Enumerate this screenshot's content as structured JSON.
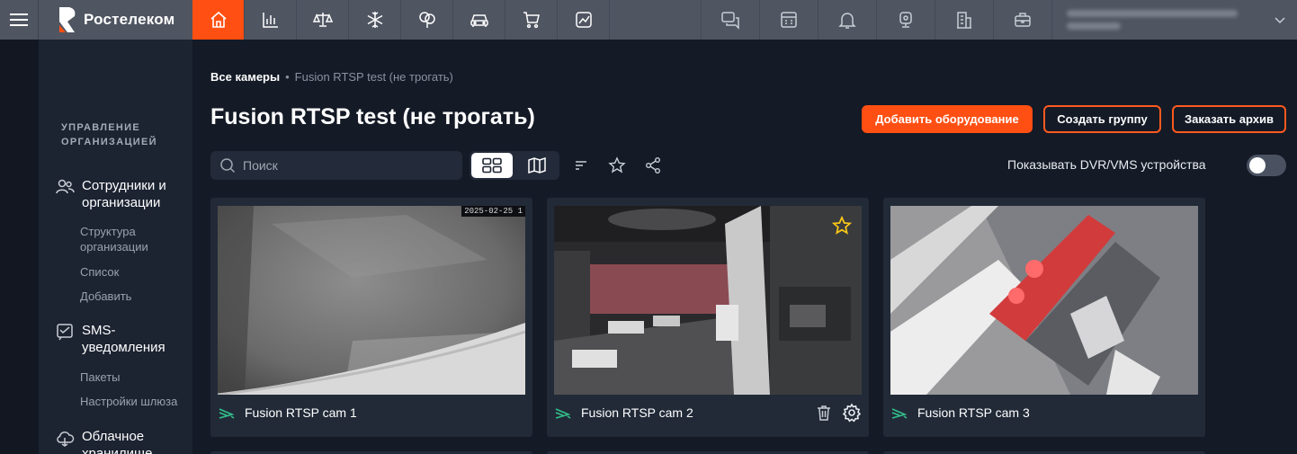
{
  "brand": {
    "name": "Ростелеком",
    "accent": "#ff4f12"
  },
  "topbar": {
    "nav_icons": [
      "home-icon",
      "chart-icon",
      "scales-icon",
      "snowflake-icon",
      "tree-icon",
      "car-icon",
      "cart-icon",
      "analytics-icon"
    ],
    "active_index": 0,
    "right_icons": [
      "chat-icon",
      "calculator-icon",
      "bell-icon",
      "webcam-icon",
      "building-icon",
      "briefcase-icon"
    ]
  },
  "sidebar": {
    "heading": "УПРАВЛЕНИЕ ОРГАНИЗАЦИЕЙ",
    "sections": [
      {
        "icon": "people-icon",
        "title": "Сотрудники и организации",
        "items": [
          "Структура организации",
          "Список",
          "Добавить"
        ]
      },
      {
        "icon": "sms-icon",
        "title": "SMS-уведомления",
        "items": [
          "Пакеты",
          "Настройки шлюза"
        ]
      },
      {
        "icon": "cloud-icon",
        "title": "Облачное хранилище",
        "items": []
      }
    ]
  },
  "breadcrumb": {
    "root": "Все камеры",
    "separator": "•",
    "current": "Fusion RTSP test (не трогать)"
  },
  "page": {
    "title": "Fusion RTSP test (не трогать)"
  },
  "actions": {
    "add_equipment": "Добавить оборудование",
    "create_group": "Создать группу",
    "order_archive": "Заказать архив"
  },
  "toolbar": {
    "search_placeholder": "Поиск",
    "show_dvr_label": "Показывать DVR/VMS устройства",
    "show_dvr_enabled": false
  },
  "cameras": [
    {
      "name": "Fusion RTSP cam 1",
      "timestamp": "2025-02-25 1",
      "favorite": false,
      "status_icon": "signal-icon"
    },
    {
      "name": "Fusion RTSP cam 2",
      "timestamp": "",
      "favorite": true,
      "status_icon": "signal-icon"
    },
    {
      "name": "Fusion RTSP cam 3",
      "timestamp": "",
      "favorite": false,
      "status_icon": "signal-icon"
    }
  ]
}
